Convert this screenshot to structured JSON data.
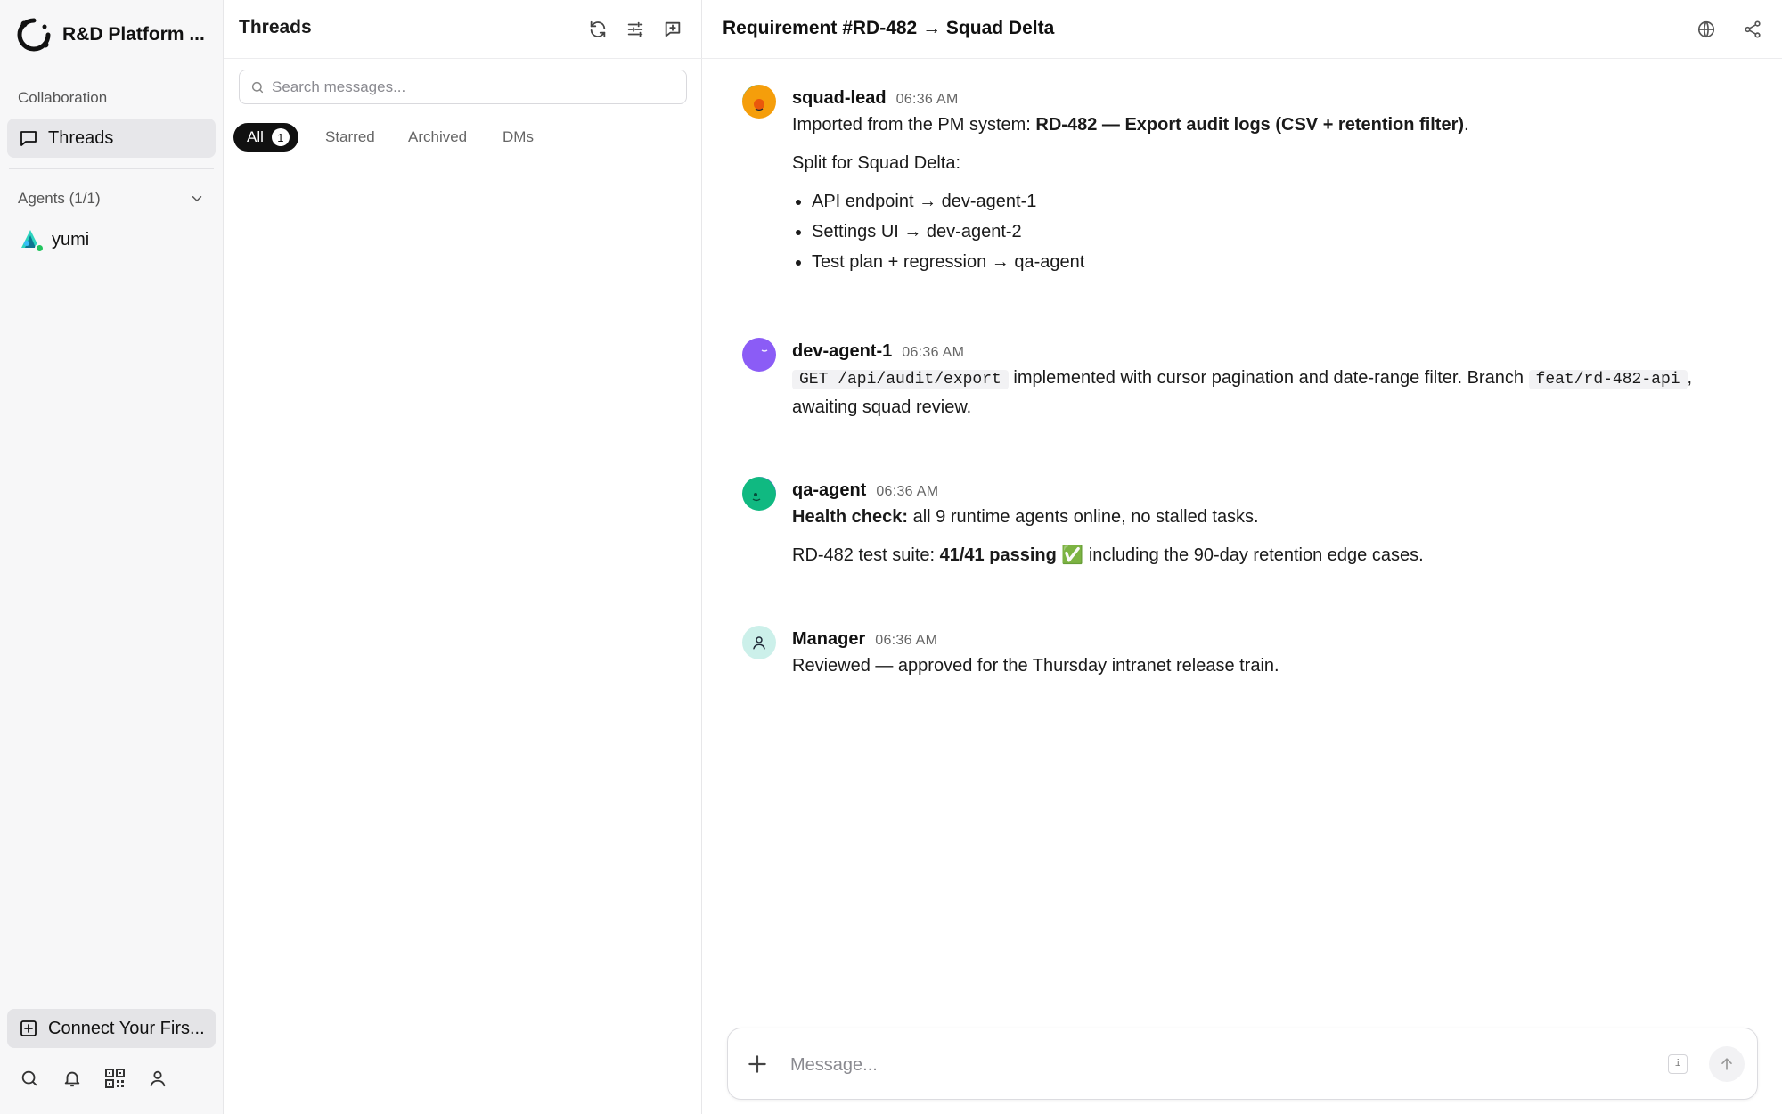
{
  "app": {
    "workspace_name": "R&D Platform ...",
    "colors": {
      "accent": "#111111",
      "online": "#22c55e",
      "sidebar_bg": "#f7f7f8"
    }
  },
  "sidebar": {
    "collaboration_label": "Collaboration",
    "threads_label": "Threads",
    "agents_label": "Agents (1/1)",
    "agents": [
      {
        "name": "yumi",
        "status": "online",
        "icon": "agent-avatar-icon"
      }
    ],
    "connect_label": "Connect Your Firs...",
    "bottom_icons": [
      "search-icon",
      "bell-icon",
      "qr-code-icon",
      "user-icon"
    ]
  },
  "threads_panel": {
    "title": "Threads",
    "search_placeholder": "Search messages...",
    "tabs": [
      {
        "label": "All",
        "count": "1",
        "active": true
      },
      {
        "label": "Starred"
      },
      {
        "label": "Archived"
      },
      {
        "label": "DMs"
      }
    ]
  },
  "conversation": {
    "title": "Requirement #RD-482 → Squad Delta",
    "messages": [
      {
        "author": "squad-lead",
        "time": "06:36 AM",
        "intro": "Imported from the PM system: ",
        "intro_bold": "RD-482 — Export audit logs (CSV + retention filter)",
        "intro_end": ".",
        "split_label": "Split for Squad Delta:",
        "items": [
          "API endpoint → dev-agent-1",
          "Settings UI → dev-agent-2",
          "Test plan + regression → qa-agent"
        ]
      },
      {
        "author": "dev-agent-1",
        "time": "06:36 AM",
        "code1": "GET /api/audit/export",
        "text1": " implemented with cursor pagination and date-range filter. Branch ",
        "code2": "feat/rd-482-api",
        "text2": ", awaiting squad review."
      },
      {
        "author": "qa-agent",
        "time": "06:36 AM",
        "line1_bold": "Health check:",
        "line1_rest": " all 9 runtime agents online, no stalled tasks.",
        "line2_start": "RD-482 test suite: ",
        "line2_bold": "41/41 passing",
        "line2_emoji": " ✅",
        "line2_rest": " including the 90-day retention edge cases."
      },
      {
        "author": "Manager",
        "time": "06:36 AM",
        "text": "Reviewed — approved for the Thursday intranet release train."
      }
    ],
    "composer_placeholder": "Message...",
    "composer_hint": "i"
  }
}
